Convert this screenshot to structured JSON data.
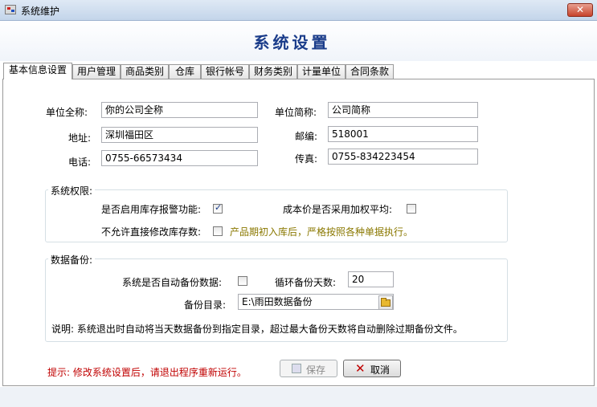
{
  "window": {
    "title": "系统维护",
    "close": "✕"
  },
  "page": {
    "title": "系统设置"
  },
  "tabs": [
    "基本信息设置",
    "用户管理",
    "商品类别",
    "仓库",
    "银行帐号",
    "财务类别",
    "计量单位",
    "合同条款"
  ],
  "company": {
    "full_name_label": "单位全称:",
    "full_name_value": "你的公司全称",
    "short_name_label": "单位简称:",
    "short_name_value": "公司简称",
    "address_label": "地址:",
    "address_value": "深圳福田区",
    "postcode_label": "邮编:",
    "postcode_value": "518001",
    "phone_label": "电话:",
    "phone_value": "0755-66573434",
    "fax_label": "传真:",
    "fax_value": "0755-834223454"
  },
  "permissions": {
    "title": "系统权限:",
    "stock_alarm_label": "是否启用库存报警功能:",
    "stock_alarm_checked": true,
    "weighted_avg_label": "成本价是否采用加权平均:",
    "weighted_avg_checked": false,
    "no_direct_edit_label": "不允许直接修改库存数:",
    "no_direct_edit_checked": false,
    "note": "产品期初入库后，严格按照各种单据执行。"
  },
  "backup": {
    "title": "数据备份:",
    "auto_label": "系统是否自动备份数据:",
    "auto_checked": false,
    "cycle_label": "循环备份天数:",
    "cycle_value": "20",
    "dir_label": "备份目录:",
    "dir_value": "E:\\雨田数据备份",
    "description": "说明: 系统退出时自动将当天数据备份到指定目录，超过最大备份天数将自动删除过期备份文件。"
  },
  "footer": {
    "hint": "提示: 修改系统设置后，请退出程序重新运行。",
    "save_label": "保存",
    "cancel_label": "取消"
  },
  "colors": {
    "title_blue": "#1a3c8a",
    "hint_red": "#c00000",
    "note_olive": "#8a7800"
  }
}
